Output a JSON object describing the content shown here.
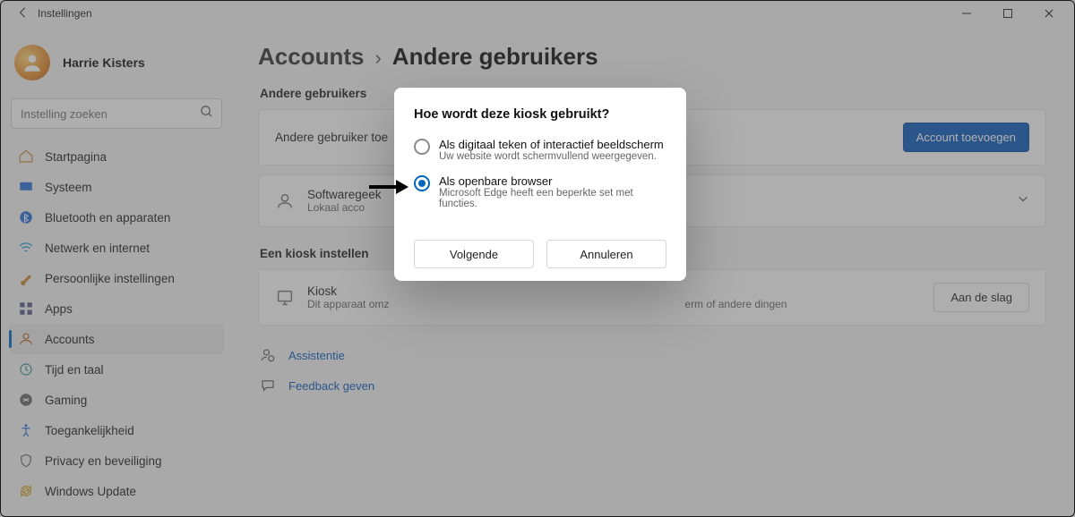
{
  "window": {
    "title": "Instellingen"
  },
  "profile": {
    "name": "Harrie Kisters"
  },
  "search": {
    "placeholder": "Instelling zoeken"
  },
  "nav": {
    "items": [
      {
        "label": "Startpagina"
      },
      {
        "label": "Systeem"
      },
      {
        "label": "Bluetooth en apparaten"
      },
      {
        "label": "Netwerk en internet"
      },
      {
        "label": "Persoonlijke instellingen"
      },
      {
        "label": "Apps"
      },
      {
        "label": "Accounts"
      },
      {
        "label": "Tijd en taal"
      },
      {
        "label": "Gaming"
      },
      {
        "label": "Toegankelijkheid"
      },
      {
        "label": "Privacy en beveiliging"
      },
      {
        "label": "Windows Update"
      }
    ]
  },
  "breadcrumb": {
    "root": "Accounts",
    "sep": "›",
    "leaf": "Andere gebruikers"
  },
  "sections": {
    "other_users": {
      "title": "Andere gebruikers",
      "add_row_label": "Andere gebruiker toe",
      "add_button": "Account toevoegen",
      "user_name": "Softwaregeek",
      "user_subtitle": "Lokaal acco"
    },
    "kiosk": {
      "title": "Een kiosk instellen",
      "row_title": "Kiosk",
      "row_subtitle_left": "Dit apparaat omz",
      "row_subtitle_right": "erm of andere dingen",
      "button": "Aan de slag"
    }
  },
  "links": {
    "assist": "Assistentie",
    "feedback": "Feedback geven"
  },
  "modal": {
    "title": "Hoe wordt deze kiosk gebruikt?",
    "option1": {
      "title": "Als digitaal teken of interactief beeldscherm",
      "subtitle": "Uw website wordt schermvullend weergegeven."
    },
    "option2": {
      "title": "Als openbare browser",
      "subtitle": "Microsoft Edge heeft een beperkte set met functies."
    },
    "next": "Volgende",
    "cancel": "Annuleren"
  }
}
